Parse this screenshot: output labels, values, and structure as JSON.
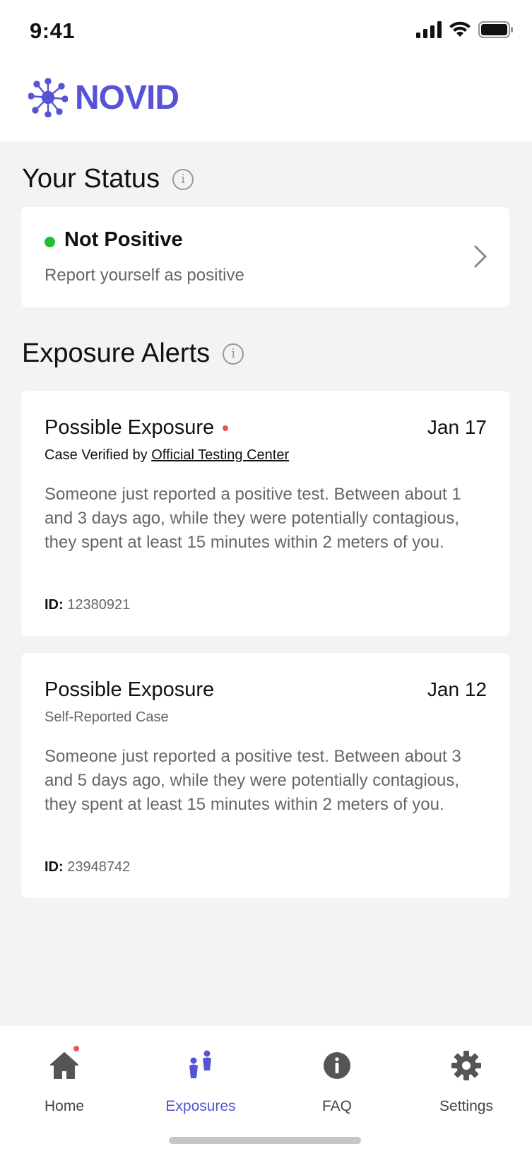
{
  "status_bar": {
    "time": "9:41"
  },
  "app": {
    "logo_text": "NOVID",
    "brand_color": "#5753d6"
  },
  "your_status": {
    "section_title": "Your Status",
    "status_label": "Not Positive",
    "status_color": "#1fbf2e",
    "action_text": "Report yourself as positive"
  },
  "exposure_alerts": {
    "section_title": "Exposure Alerts",
    "alerts": [
      {
        "title": "Possible Exposure",
        "unread": true,
        "date": "Jan 17",
        "verification_prefix": "Case Verified by ",
        "verification_link": "Official Testing Center",
        "body": "Someone just reported a positive test. Between about 1 and 3 days ago, while they were potentially contagious, they spent at least 15 minutes within 2 meters of you.",
        "id_label": "ID:",
        "id_value": "12380921"
      },
      {
        "title": "Possible Exposure",
        "unread": false,
        "date": "Jan 12",
        "source": "Self-Reported Case",
        "body": "Someone just reported a positive test. Between about 3 and 5 days ago, while they were potentially contagious, they spent at least 15 minutes within 2 meters of you.",
        "id_label": "ID:",
        "id_value": "23948742"
      }
    ]
  },
  "tab_bar": {
    "tabs": [
      {
        "label": "Home",
        "icon": "home-icon",
        "has_notification": true
      },
      {
        "label": "Exposures",
        "icon": "people-icon",
        "active": true
      },
      {
        "label": "FAQ",
        "icon": "info-icon"
      },
      {
        "label": "Settings",
        "icon": "gear-icon"
      }
    ]
  }
}
